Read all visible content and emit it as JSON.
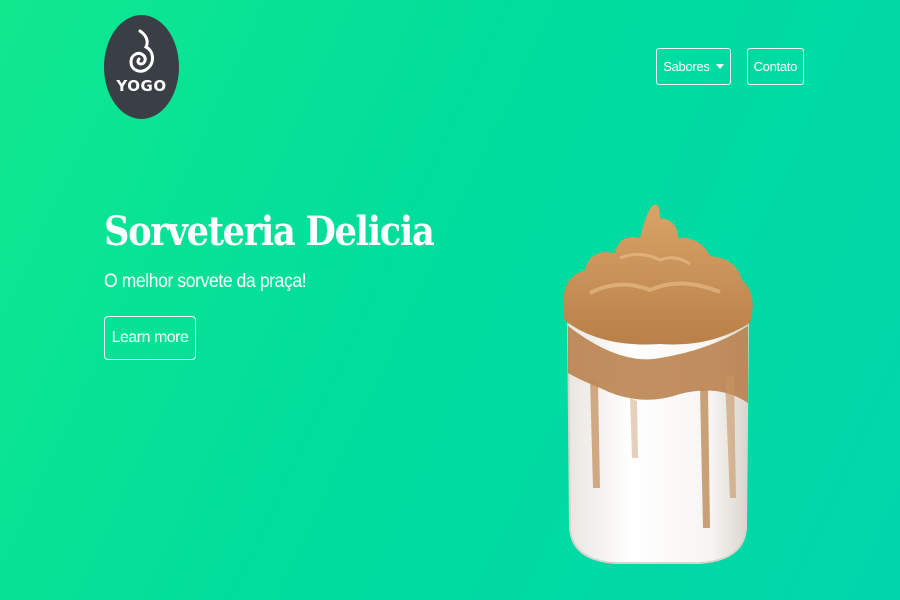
{
  "logo": {
    "text": "YOGO"
  },
  "nav": {
    "flavors_label": "Sabores",
    "contact_label": "Contato"
  },
  "hero": {
    "title": "Sorveteria Delicia",
    "subtitle": "O melhor sorvete da praça!",
    "cta_label": "Learn more"
  },
  "colors": {
    "background_start": "#10e88e",
    "background_end": "#00d6ac",
    "logo_bg": "#3a3f45",
    "text": "#ffffff"
  },
  "icons": {
    "logo_mark": "swirl-icon",
    "dropdown": "caret-down-icon"
  },
  "product_image": "dalgona-coffee-glass"
}
